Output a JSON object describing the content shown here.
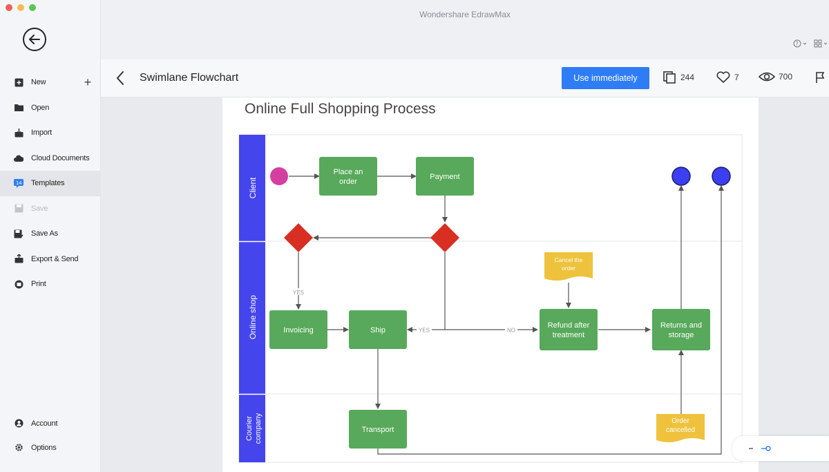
{
  "window": {
    "app_title": "Wondershare EdrawMax"
  },
  "sidebar": {
    "menu": [
      {
        "label": "New",
        "icon": "new-icon"
      },
      {
        "label": "Open",
        "icon": "folder-icon"
      },
      {
        "label": "Import",
        "icon": "import-icon"
      },
      {
        "label": "Cloud Documents",
        "icon": "cloud-icon"
      },
      {
        "label": "Templates",
        "icon": "templates-icon",
        "active": true
      },
      {
        "label": "Save",
        "icon": "save-icon",
        "disabled": true
      },
      {
        "label": "Save As",
        "icon": "save-as-icon"
      },
      {
        "label": "Export & Send",
        "icon": "export-icon"
      },
      {
        "label": "Print",
        "icon": "print-icon"
      }
    ],
    "bottom": [
      {
        "label": "Account",
        "icon": "account-icon"
      },
      {
        "label": "Options",
        "icon": "gear-icon"
      }
    ]
  },
  "header": {
    "title": "Swimlane Flowchart",
    "use_button": "Use immediately",
    "copies": "244",
    "likes": "7",
    "views": "700"
  },
  "diagram": {
    "title": "Online Full Shopping Process",
    "lanes": [
      "Client",
      "Online shop",
      "Courier company"
    ],
    "nodes": {
      "place_order": "Place an order",
      "payment": "Payment",
      "invoicing": "Invoicing",
      "ship": "Ship",
      "refund": "Refund after treatment",
      "returns": "Returns and storage",
      "transport": "Transport",
      "cancel_order": "Cancel the order",
      "order_cancelled": "Order cancelled"
    },
    "edge_labels": {
      "yes1": "YES",
      "yes2": "YES",
      "no": "NO"
    }
  },
  "colors": {
    "lane_header": "#4545ee",
    "process": "#58a95b",
    "decision": "#d92e22",
    "start": "#d43fa2",
    "end": "#3b3ff0",
    "note": "#eec23c",
    "accent": "#2f7df6"
  }
}
